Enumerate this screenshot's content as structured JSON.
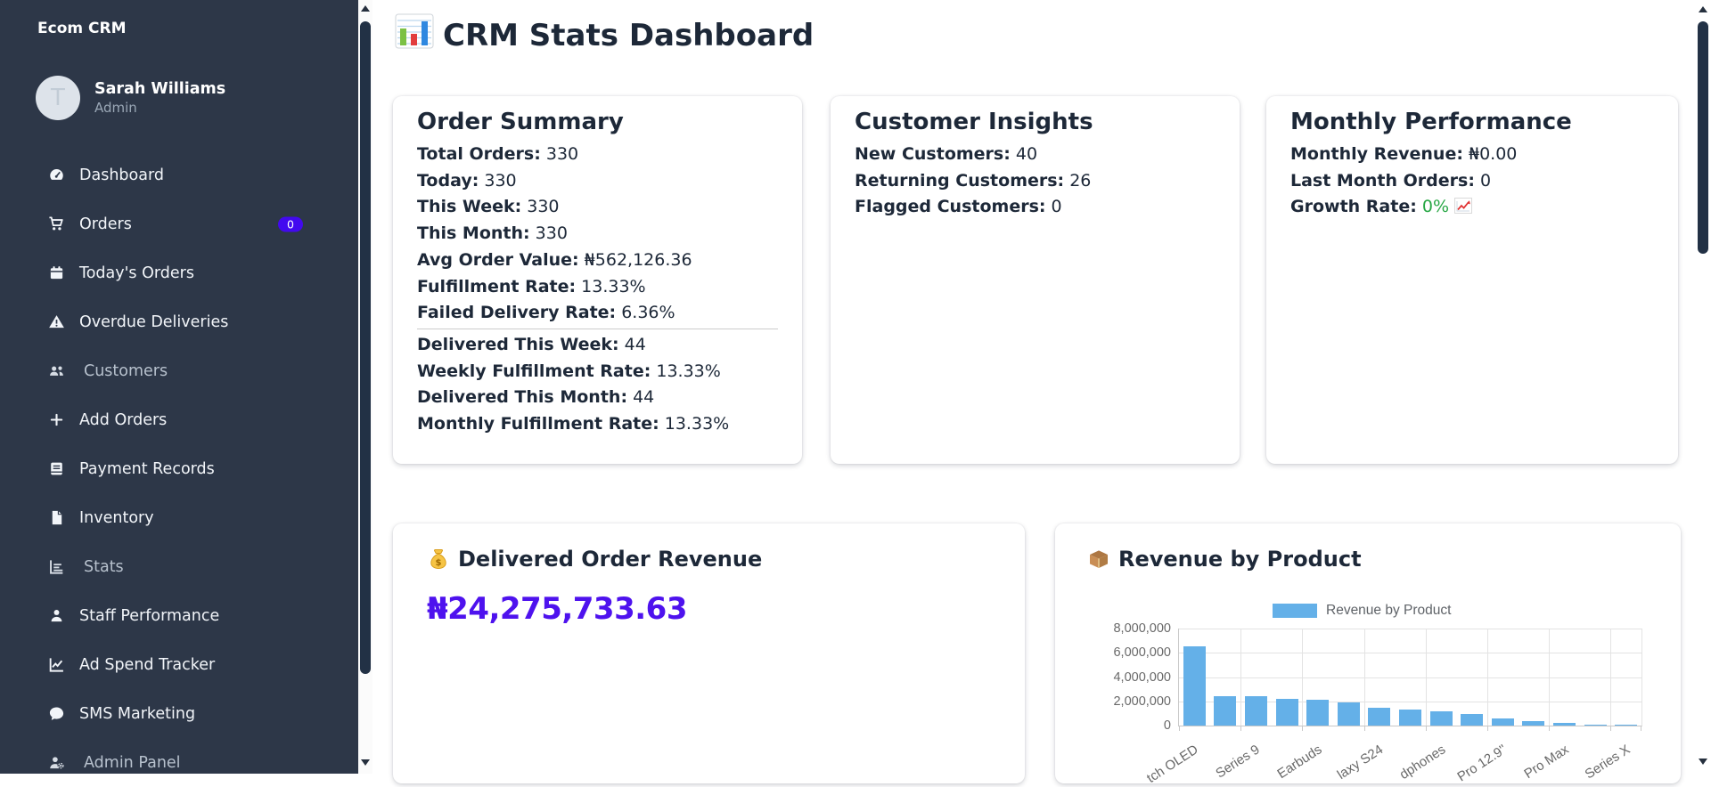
{
  "sidebar": {
    "brand": "Ecom CRM",
    "user": {
      "initial": "T",
      "name": "Sarah Williams",
      "role": "Admin"
    },
    "items": [
      {
        "label": "Dashboard",
        "icon": "gauge"
      },
      {
        "label": "Orders",
        "icon": "cart",
        "badge": "0"
      },
      {
        "label": "Today's Orders",
        "icon": "calendar"
      },
      {
        "label": "Overdue Deliveries",
        "icon": "warning"
      },
      {
        "label": "Customers",
        "icon": "users",
        "dim": true
      },
      {
        "label": "Add Orders",
        "icon": "plus"
      },
      {
        "label": "Payment Records",
        "icon": "book"
      },
      {
        "label": "Inventory",
        "icon": "file"
      },
      {
        "label": "Stats",
        "icon": "chart-bar",
        "dim": true
      },
      {
        "label": "Staff Performance",
        "icon": "user"
      },
      {
        "label": "Ad Spend Tracker",
        "icon": "chart-line"
      },
      {
        "label": "SMS Marketing",
        "icon": "comment"
      },
      {
        "label": "Admin Panel",
        "icon": "user-gear",
        "dim": true
      }
    ]
  },
  "header": {
    "title": "CRM Stats Dashboard"
  },
  "cards": {
    "order_summary": {
      "title": "Order Summary",
      "divider_after": 7,
      "rows": [
        {
          "label": "Total Orders:",
          "value": "330"
        },
        {
          "label": "Today:",
          "value": "330"
        },
        {
          "label": "This Week:",
          "value": "330"
        },
        {
          "label": "This Month:",
          "value": "330"
        },
        {
          "label": "Avg Order Value:",
          "value": "₦562,126.36"
        },
        {
          "label": "Fulfillment Rate:",
          "value": "13.33%"
        },
        {
          "label": "Failed Delivery Rate:",
          "value": "6.36%"
        },
        {
          "label": "Delivered This Week:",
          "value": "44"
        },
        {
          "label": "Weekly Fulfillment Rate:",
          "value": "13.33%"
        },
        {
          "label": "Delivered This Month:",
          "value": "44"
        },
        {
          "label": "Monthly Fulfillment Rate:",
          "value": "13.33%"
        }
      ]
    },
    "customer_insights": {
      "title": "Customer Insights",
      "rows": [
        {
          "label": "New Customers:",
          "value": "40"
        },
        {
          "label": "Returning Customers:",
          "value": "26"
        },
        {
          "label": "Flagged Customers:",
          "value": "0"
        }
      ]
    },
    "monthly_performance": {
      "title": "Monthly Performance",
      "rows": [
        {
          "label": "Monthly Revenue:",
          "value": "₦0.00"
        },
        {
          "label": "Last Month Orders:",
          "value": "0"
        },
        {
          "label": "Growth Rate:",
          "value": "0%",
          "color": "#28a745",
          "icon": "chart-up"
        }
      ]
    }
  },
  "revenue_section": {
    "title": "Delivered Order Revenue",
    "amount": "₦24,275,733.63"
  },
  "chart_section": {
    "title": "Revenue by Product"
  },
  "chart_data": {
    "type": "bar",
    "title": "Revenue by Product",
    "legend": "Revenue by Product",
    "legend_position": "top",
    "grid": true,
    "ylim": [
      0,
      8000000
    ],
    "yticks": [
      0,
      2000000,
      4000000,
      6000000,
      8000000
    ],
    "ytick_labels": [
      "0",
      "2,000,000",
      "4,000,000",
      "6,000,000",
      "8,000,000"
    ],
    "values": [
      6500000,
      2420000,
      2400000,
      2200000,
      2150000,
      1880000,
      1450000,
      1350000,
      1180000,
      980000,
      600000,
      340000,
      240000,
      110000,
      60000
    ],
    "x_labels_visible": [
      "tch OLED",
      "Series 9",
      "Earbuds",
      "laxy S24",
      "dphones",
      "Pro 12.9\"",
      "Pro Max",
      "Series X"
    ],
    "series_color": "#64b0e8"
  },
  "colors": {
    "accent_purple": "#4e12ee",
    "badge_bg": "#4209ef",
    "growth_green": "#28a745",
    "bar_blue": "#64b0e8",
    "sidebar_bg": "#2d3748"
  }
}
